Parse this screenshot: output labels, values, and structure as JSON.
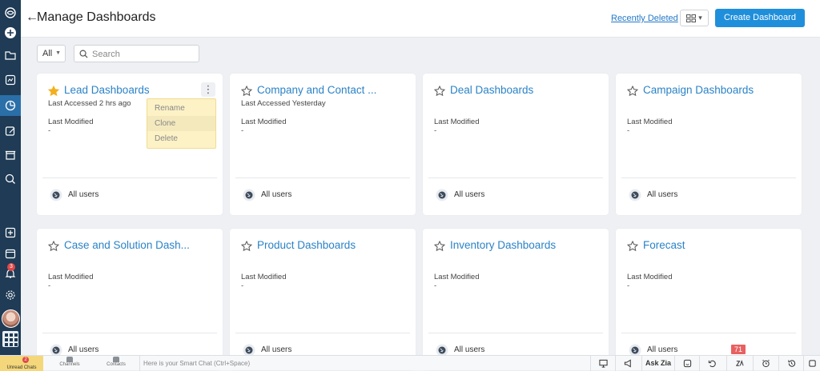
{
  "header": {
    "title": "Manage Dashboards",
    "recently_deleted": "Recently Deleted",
    "create_button": "Create Dashboard"
  },
  "filter": {
    "selected": "All",
    "search_placeholder": "Search"
  },
  "cards": [
    {
      "title": "Lead Dashboards",
      "favorite": true,
      "accessed": "Last Accessed 2 hrs ago",
      "last_modified_label": "Last Modified",
      "last_modified": "-",
      "sharing": "All users"
    },
    {
      "title": "Company and Contact ...",
      "favorite": false,
      "accessed": "Last Accessed Yesterday",
      "last_modified_label": "Last Modified",
      "last_modified": "-",
      "sharing": "All users"
    },
    {
      "title": "Deal Dashboards",
      "favorite": false,
      "accessed": "",
      "last_modified_label": "Last Modified",
      "last_modified": "-",
      "sharing": "All users"
    },
    {
      "title": "Campaign Dashboards",
      "favorite": false,
      "accessed": "",
      "last_modified_label": "Last Modified",
      "last_modified": "-",
      "sharing": "All users"
    },
    {
      "title": "Case and Solution Dash...",
      "favorite": false,
      "accessed": "",
      "last_modified_label": "Last Modified",
      "last_modified": "-",
      "sharing": "All users"
    },
    {
      "title": "Product Dashboards",
      "favorite": false,
      "accessed": "",
      "last_modified_label": "Last Modified",
      "last_modified": "-",
      "sharing": "All users"
    },
    {
      "title": "Inventory Dashboards",
      "favorite": false,
      "accessed": "",
      "last_modified_label": "Last Modified",
      "last_modified": "-",
      "sharing": "All users"
    },
    {
      "title": "Forecast",
      "favorite": false,
      "accessed": "",
      "last_modified_label": "Last Modified",
      "last_modified": "-",
      "sharing": "All users"
    }
  ],
  "context_menu": {
    "items": [
      "Rename",
      "Clone",
      "Delete"
    ]
  },
  "sidebar": {
    "notification_badge": "3"
  },
  "bottom_bar": {
    "unread_chats": "Unread Chats",
    "unread_badge": "2",
    "channels": "Channels",
    "contacts": "Contacts",
    "smart_chat": "Here is your Smart Chat (Ctrl+Space)",
    "ask_zia": "Ask Zia",
    "count_badge": "71"
  },
  "colors": {
    "sidebar": "#1f3b55",
    "accent": "#1f8fdb",
    "title_link": "#2b83c7",
    "favorite_star": "#f2b01e"
  }
}
